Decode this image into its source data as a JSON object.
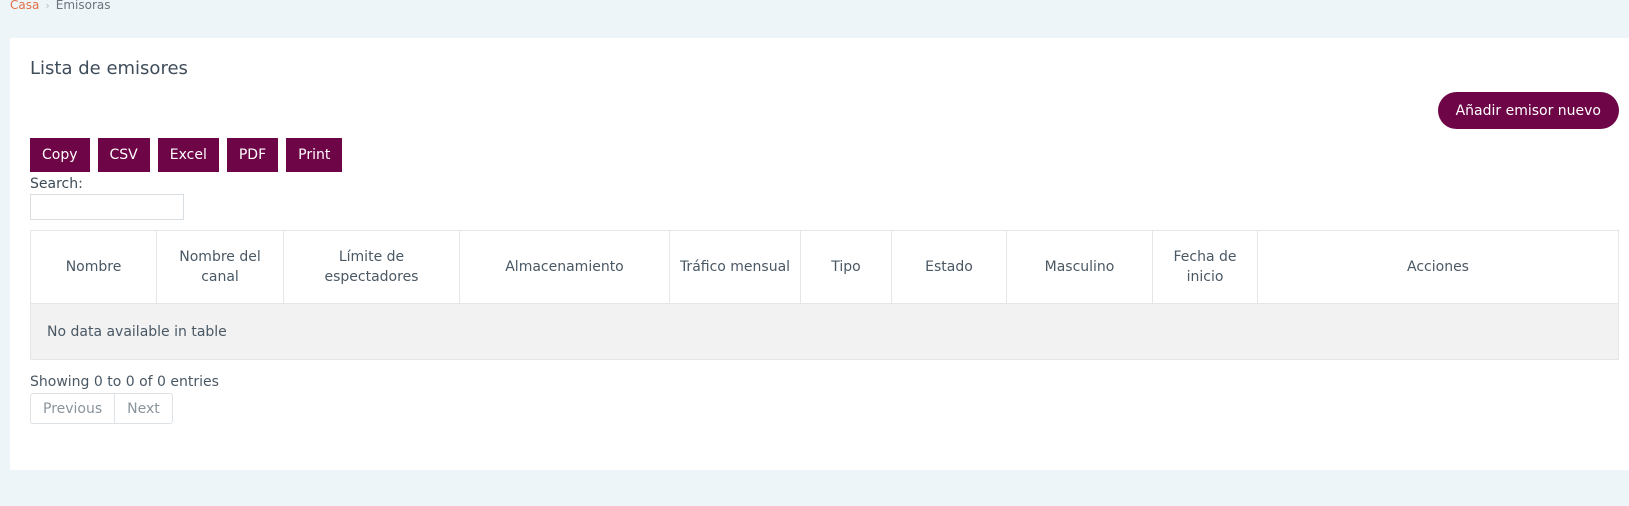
{
  "breadcrumb": {
    "home": "Casa",
    "current": "Emisoras"
  },
  "card": {
    "title": "Lista de emisores",
    "add_button": "Añadir emisor nuevo"
  },
  "export_buttons": [
    "Copy",
    "CSV",
    "Excel",
    "PDF",
    "Print"
  ],
  "search": {
    "label": "Search:",
    "value": "",
    "placeholder": ""
  },
  "table": {
    "columns": [
      "Nombre",
      "Nombre del canal",
      "Límite de espectadores",
      "Almacenamiento",
      "Tráfico mensual",
      "Tipo",
      "Estado",
      "Masculino",
      "Fecha de inicio",
      "Acciones"
    ],
    "empty_message": "No data available in table"
  },
  "footer": {
    "info": "Showing 0 to 0 of 0 entries",
    "previous": "Previous",
    "next": "Next"
  },
  "colors": {
    "primary": "#6d0546",
    "breadcrumb_link": "#e2704a",
    "background": "#eef5f8"
  },
  "icons": {
    "breadcrumb_separator": "chevron-right-icon"
  }
}
